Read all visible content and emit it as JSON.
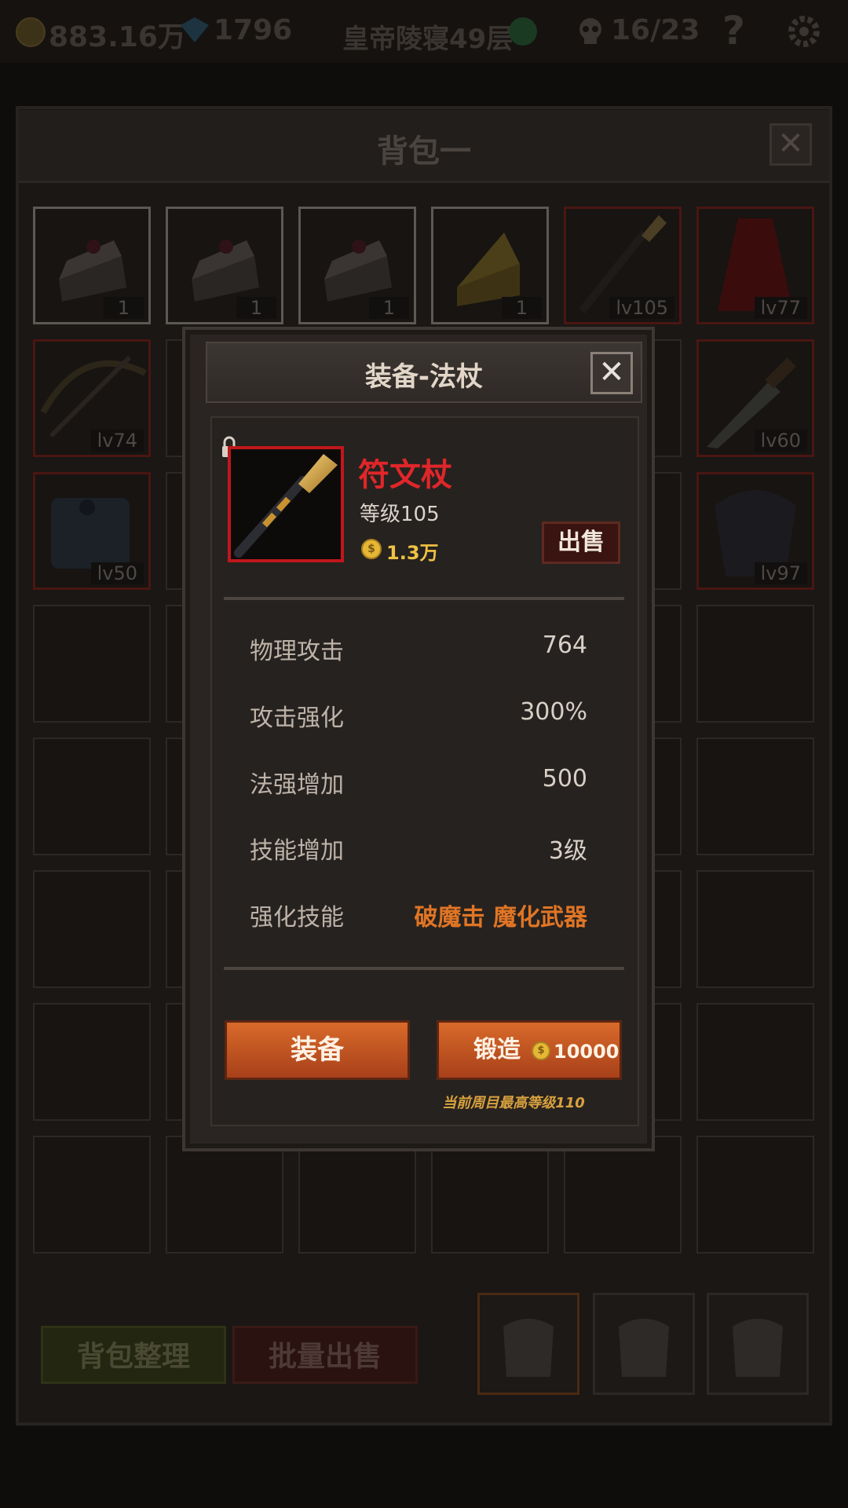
{
  "topbar": {
    "gold": "883.16万",
    "gems": "1796",
    "dungeon": "皇帝陵寝49层",
    "kills": "16/23",
    "help": "?"
  },
  "bag": {
    "title": "背包一",
    "close": "✕",
    "items": [
      {
        "icon": "cake-icon",
        "badge": "1",
        "frame": "white"
      },
      {
        "icon": "cake-icon",
        "badge": "1",
        "frame": "white"
      },
      {
        "icon": "cake-icon",
        "badge": "1",
        "frame": "white"
      },
      {
        "icon": "cheese-icon",
        "badge": "1",
        "frame": "white"
      },
      {
        "icon": "staff-icon",
        "badge": "lv105",
        "frame": "red"
      },
      {
        "icon": "cloak-icon",
        "badge": "lv77",
        "frame": "red"
      },
      {
        "icon": "crossbow-icon",
        "badge": "lv74",
        "frame": "red"
      },
      {
        "icon": "dagger-icon",
        "badge": "lv60",
        "frame": "red"
      },
      {
        "icon": "bracer-icon",
        "badge": "lv50",
        "frame": "red"
      },
      {
        "icon": "armor-icon",
        "badge": "lv97",
        "frame": "red"
      }
    ],
    "sort_label": "背包整理",
    "bulk_sell_label": "批量出售"
  },
  "dialog": {
    "title": "装备-法杖",
    "close": "✕",
    "item": {
      "name": "符文杖",
      "level": "等级105",
      "price": "1.3万",
      "icon": "staff-icon",
      "lock": "lock-icon"
    },
    "sell_label": "出售",
    "stats": [
      {
        "label": "物理攻击",
        "value": "764"
      },
      {
        "label": "攻击强化",
        "value": "300%"
      },
      {
        "label": "法强增加",
        "value": "500"
      },
      {
        "label": "技能增加",
        "value": "3级"
      },
      {
        "label": "强化技能",
        "value": "破魔击 魔化武器"
      }
    ],
    "equip_label": "装备",
    "forge_label": "锻造",
    "forge_cost": "10000",
    "note": "当前周目最高等级110"
  },
  "colors": {
    "item_name": "#e0262a",
    "gold": "#f0c244",
    "skill": "#e07525",
    "button": "#c85a24"
  }
}
